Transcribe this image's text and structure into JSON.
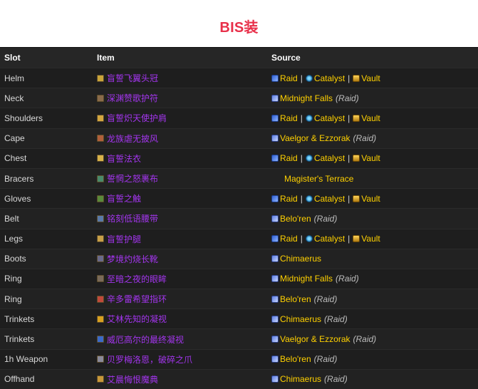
{
  "title": "BIS装",
  "headers": {
    "slot": "Slot",
    "item": "Item",
    "source": "Source"
  },
  "rows": [
    {
      "slot": "Helm",
      "item": "盲誓飞翼头冠",
      "item_icon": "helm-icon",
      "icon_color": "#c9a43a",
      "sources": [
        "Raid",
        "Catalyst",
        "Vault"
      ],
      "note": ""
    },
    {
      "slot": "Neck",
      "item": "深渊赞歌护符",
      "item_icon": "neck-icon",
      "icon_color": "#8a6b4a",
      "sources": [
        "Midnight Falls"
      ],
      "note": "(Raid)"
    },
    {
      "slot": "Shoulders",
      "item": "盲誓炽天使护肩",
      "item_icon": "shoulders-icon",
      "icon_color": "#d4a640",
      "sources": [
        "Raid",
        "Catalyst",
        "Vault"
      ],
      "note": ""
    },
    {
      "slot": "Cape",
      "item": "龙族虐无披风",
      "item_icon": "cape-icon",
      "icon_color": "#b0603a",
      "sources": [
        "Vaelgor & Ezzorak"
      ],
      "note": "(Raid)"
    },
    {
      "slot": "Chest",
      "item": "盲誓法衣",
      "item_icon": "chest-icon",
      "icon_color": "#d8b24a",
      "sources": [
        "Raid",
        "Catalyst",
        "Vault"
      ],
      "note": ""
    },
    {
      "slot": "Bracers",
      "item": "誓惘之怒裹布",
      "item_icon": "bracers-icon",
      "icon_color": "#4a8a6a",
      "sources": [
        "Magister's Terrace"
      ],
      "note": ""
    },
    {
      "slot": "Gloves",
      "item": "盲誓之触",
      "item_icon": "gloves-icon",
      "icon_color": "#5a8a3a",
      "sources": [
        "Raid",
        "Catalyst",
        "Vault"
      ],
      "note": ""
    },
    {
      "slot": "Belt",
      "item": "铭刻低语腰带",
      "item_icon": "belt-icon",
      "icon_color": "#5a7aa8",
      "sources": [
        "Belo'ren"
      ],
      "note": "(Raid)"
    },
    {
      "slot": "Legs",
      "item": "盲誓护腿",
      "item_icon": "legs-icon",
      "icon_color": "#c8a048",
      "sources": [
        "Raid",
        "Catalyst",
        "Vault"
      ],
      "note": ""
    },
    {
      "slot": "Boots",
      "item": "梦境灼烧长靴",
      "item_icon": "boots-icon",
      "icon_color": "#6a6a8a",
      "sources": [
        "Chimaerus"
      ],
      "note": ""
    },
    {
      "slot": "Ring",
      "item": "至暗之夜的眼眸",
      "item_icon": "ring-icon",
      "icon_color": "#7a6a5a",
      "sources": [
        "Midnight Falls"
      ],
      "note": "(Raid)"
    },
    {
      "slot": "Ring",
      "item": "辛多雷希望指环",
      "item_icon": "ring2-icon",
      "icon_color": "#c04a3a",
      "sources": [
        "Belo'ren"
      ],
      "note": "(Raid)"
    },
    {
      "slot": "Trinkets",
      "item": "艾林先知的凝视",
      "item_icon": "trinket-icon",
      "icon_color": "#d8a020",
      "sources": [
        "Chimaerus"
      ],
      "note": "(Raid)"
    },
    {
      "slot": "Trinkets",
      "item": "威厄高尔的最终凝视",
      "item_icon": "trinket2-icon",
      "icon_color": "#3a6ac8",
      "sources": [
        "Vaelgor & Ezzorak"
      ],
      "note": "(Raid)"
    },
    {
      "slot": "1h Weapon",
      "item": "贝罗梅洛恩，破碎之爪",
      "item_icon": "weapon-icon",
      "icon_color": "#8a8a9a",
      "sources": [
        "Belo'ren"
      ],
      "note": "(Raid)"
    },
    {
      "slot": "Offhand",
      "item": "艾晨悔恨魔典",
      "item_icon": "offhand-icon",
      "icon_color": "#c8983a",
      "sources": [
        "Chimaerus"
      ],
      "note": "(Raid)"
    }
  ],
  "source_icons": {
    "Raid": "raid-icon",
    "Catalyst": "catalyst-icon",
    "Vault": "vault-icon",
    "Midnight Falls": "boss-icon",
    "Vaelgor & Ezzorak": "boss-icon",
    "Magister's Terrace": "dungeon-icon",
    "Belo'ren": "boss-icon",
    "Chimaerus": "boss-icon"
  },
  "colors": {
    "title": "#e8304a",
    "item_epic": "#a335ee",
    "source_link": "#ffd100",
    "table_bg": "#1e1e1e"
  }
}
